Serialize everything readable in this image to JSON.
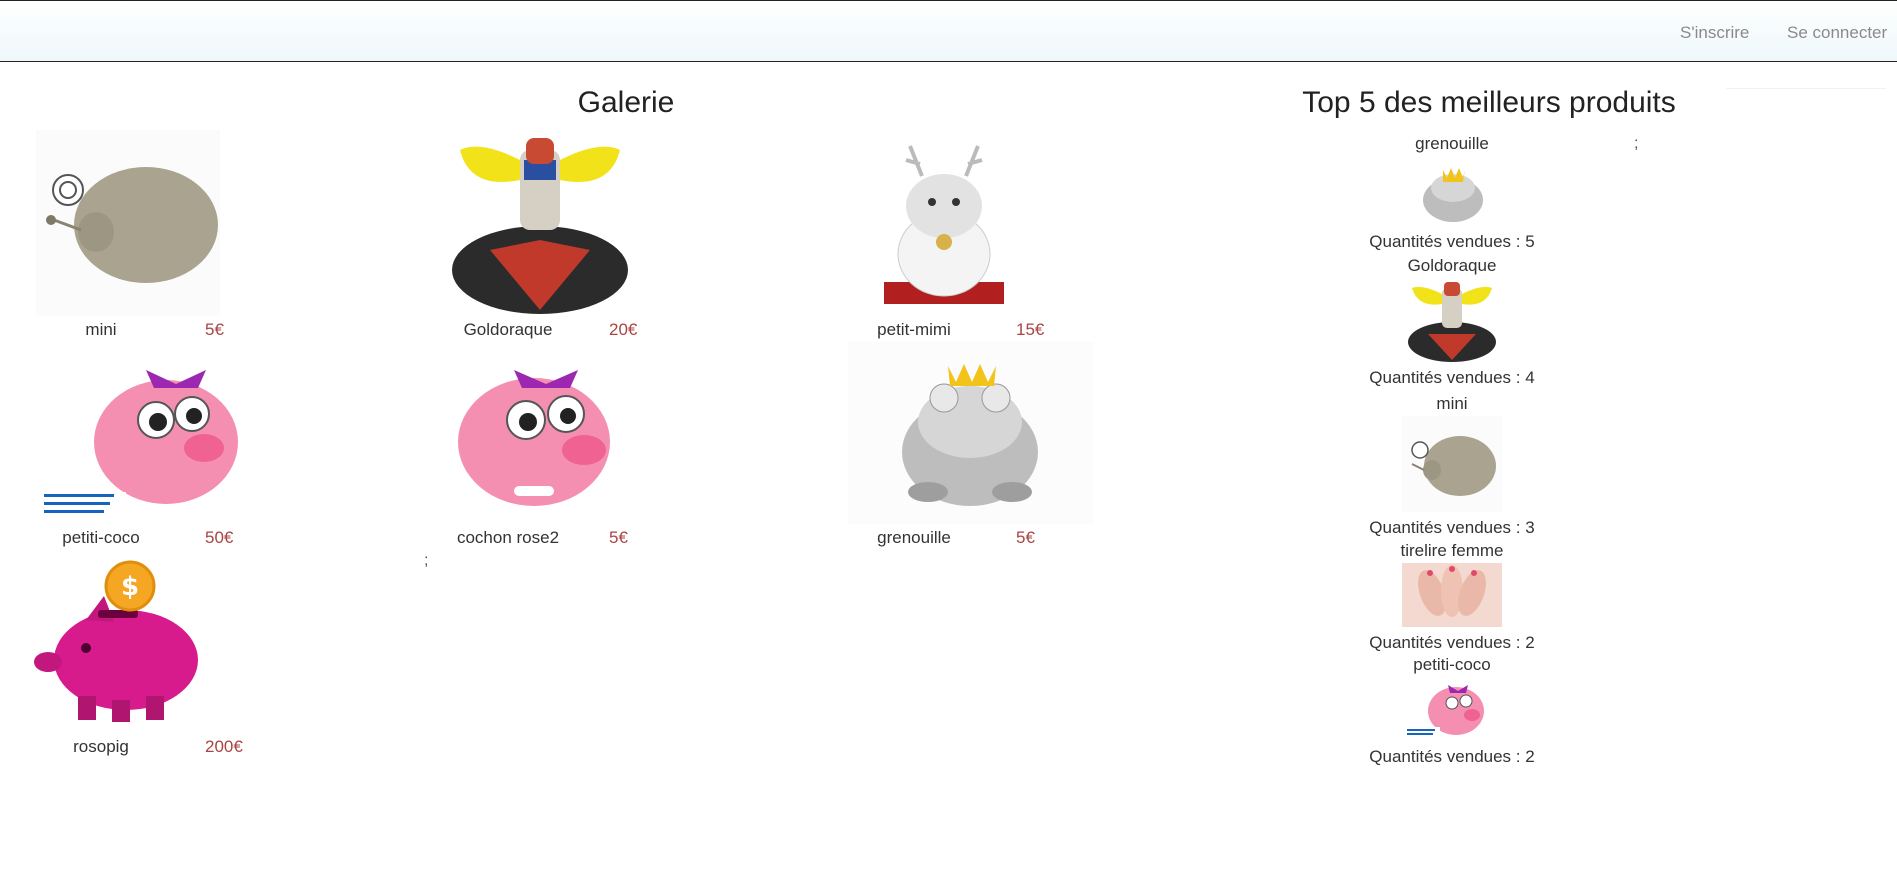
{
  "nav": {
    "signup": "S'inscrire",
    "login": "Se connecter"
  },
  "gallery": {
    "title": "Galerie",
    "stray": ";",
    "products": [
      {
        "name": "mini",
        "price": "5€"
      },
      {
        "name": "Goldoraque",
        "price": "20€"
      },
      {
        "name": "petit-mimi",
        "price": "15€"
      },
      {
        "name": "petiti-coco",
        "price": "50€"
      },
      {
        "name": "cochon rose2",
        "price": "5€"
      },
      {
        "name": "grenouille",
        "price": "5€"
      },
      {
        "name": "rosopig",
        "price": "200€"
      }
    ]
  },
  "top": {
    "title": "Top 5 des meilleurs produits",
    "stray": ";",
    "items": [
      {
        "name": "grenouille",
        "qty": "Quantités vendues : 5"
      },
      {
        "name": "Goldoraque",
        "qty": "Quantités vendues : 4"
      },
      {
        "name": "mini",
        "qty": "Quantités vendues : 3"
      },
      {
        "name": "tirelire femme",
        "qty": "Quantités vendues : 2"
      },
      {
        "name": "petiti-coco",
        "qty": "Quantités vendues : 2"
      }
    ]
  },
  "colors": {
    "price": "#a94442",
    "nav_link": "#8a8a8a"
  }
}
